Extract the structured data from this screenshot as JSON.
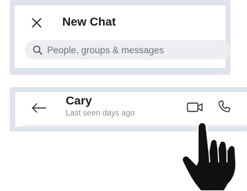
{
  "new_chat": {
    "title": "New Chat",
    "close_icon": "close-icon",
    "search": {
      "placeholder": "People, groups & messages",
      "icon": "search-icon"
    }
  },
  "conversation": {
    "back_icon": "arrow-left-icon",
    "contact_name": "Cary",
    "status": "Last seen days ago",
    "video_icon": "video-camera-icon",
    "call_icon": "phone-icon"
  },
  "overlay": {
    "pointer_icon": "hand-pointer-icon"
  },
  "colors": {
    "panel_frame": "#dfe4ec",
    "search_bg": "#eceef1",
    "text_primary": "#1b1b1b",
    "text_secondary": "#8a8f96"
  }
}
